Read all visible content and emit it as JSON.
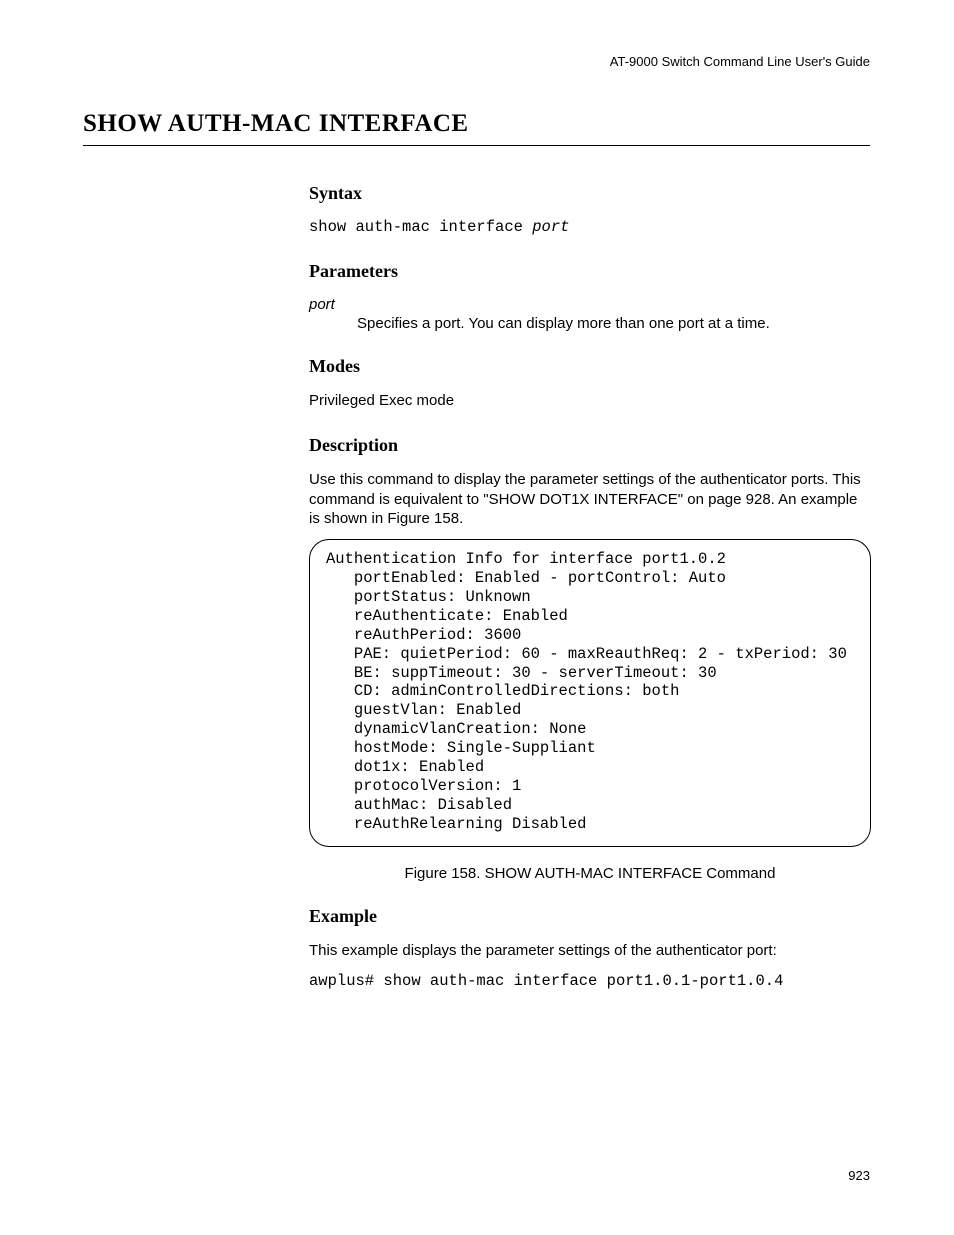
{
  "header": "AT-9000 Switch Command Line User's Guide",
  "title": "SHOW AUTH-MAC INTERFACE",
  "syntax": {
    "heading": "Syntax",
    "cmd_prefix": "show auth-mac interface ",
    "cmd_arg": "port"
  },
  "parameters": {
    "heading": "Parameters",
    "name": "port",
    "desc": "Specifies a port. You can display more than one port at a time."
  },
  "modes": {
    "heading": "Modes",
    "text": "Privileged Exec mode"
  },
  "description": {
    "heading": "Description",
    "text": "Use this command to display the parameter settings of the authenticator ports. This command is equivalent to \"SHOW DOT1X INTERFACE\" on page 928. An example is shown in Figure 158."
  },
  "codebox_lines": [
    "Authentication Info for interface port1.0.2",
    "   portEnabled: Enabled - portControl: Auto",
    "   portStatus: Unknown",
    "   reAuthenticate: Enabled",
    "   reAuthPeriod: 3600",
    "   PAE: quietPeriod: 60 - maxReauthReq: 2 - txPeriod: 30",
    "   BE: suppTimeout: 30 - serverTimeout: 30",
    "   CD: adminControlledDirections: both",
    "   guestVlan: Enabled",
    "   dynamicVlanCreation: None",
    "   hostMode: Single-Suppliant",
    "   dot1x: Enabled",
    "   protocolVersion: 1",
    "   authMac: Disabled",
    "   reAuthRelearning Disabled"
  ],
  "figure_caption": "Figure 158. SHOW AUTH-MAC INTERFACE Command",
  "example": {
    "heading": "Example",
    "text": "This example displays the parameter settings of the authenticator port:",
    "cmd": "awplus# show auth-mac interface port1.0.1-port1.0.4"
  },
  "page_number": "923"
}
